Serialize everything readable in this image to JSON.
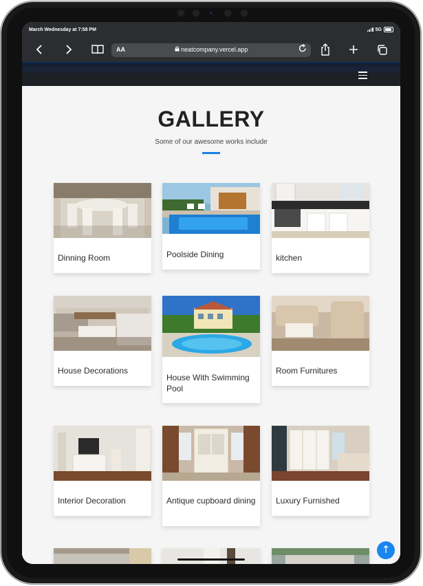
{
  "status_bar": {
    "datetime": "March Wednesday at 7:58 PM",
    "network": "5G"
  },
  "browser": {
    "text_size_label": "AA",
    "url": "neatcompany.vercel.app",
    "icons": [
      "chevron-left-icon",
      "chevron-right-icon",
      "book-icon",
      "lock-icon",
      "reload-icon",
      "share-icon",
      "plus-icon",
      "tabs-icon"
    ]
  },
  "gallery": {
    "title": "GALLERY",
    "subtitle": "Some of our awesome works include",
    "accent_color": "#1d7fe8",
    "items": [
      {
        "caption": "Dinning Room"
      },
      {
        "caption": "Poolside Dining"
      },
      {
        "caption": "kitchen"
      },
      {
        "caption": "House Decorations"
      },
      {
        "caption": "House With Swimming Pool"
      },
      {
        "caption": "Room Furnitures"
      },
      {
        "caption": "Interior Decoration"
      },
      {
        "caption": "Antique cupboard dining"
      },
      {
        "caption": "Luxury Furnished"
      }
    ]
  },
  "scroll_top_button": {
    "icon": "arrow-up-icon",
    "color": "#1a86f0"
  }
}
